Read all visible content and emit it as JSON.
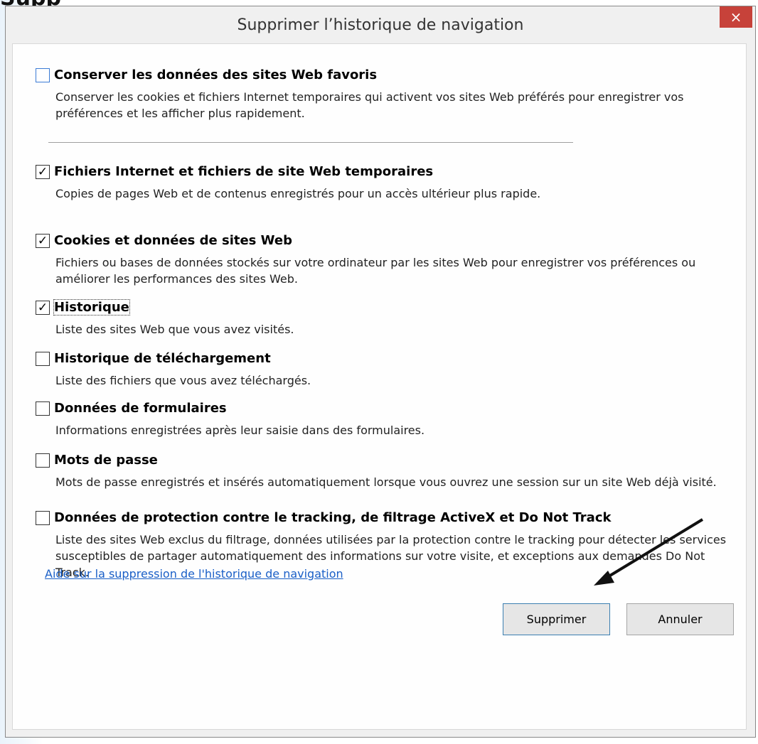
{
  "background": {
    "partial_title": "Supp"
  },
  "dialog": {
    "title": "Supprimer l’historique de navigation",
    "close_icon": "×"
  },
  "options": [
    {
      "checked": false,
      "title": "Conserver les données des sites Web favoris",
      "description": "Conserver les cookies et fichiers Internet temporaires qui activent vos sites Web préférés pour enregistrer vos préférences et les afficher plus rapidement."
    },
    {
      "checked": true,
      "title": "Fichiers Internet et fichiers de site Web temporaires",
      "description": "Copies de pages Web et de contenus enregistrés pour un accès ultérieur plus rapide."
    },
    {
      "checked": true,
      "title": "Cookies et données de sites Web",
      "description": "Fichiers ou bases de données stockés sur votre ordinateur par les sites Web pour enregistrer vos préférences ou améliorer les performances des sites Web."
    },
    {
      "checked": true,
      "title": "Historique",
      "description": "Liste des sites Web que vous avez visités."
    },
    {
      "checked": false,
      "title": "Historique de téléchargement",
      "description": "Liste des fichiers que vous avez téléchargés."
    },
    {
      "checked": false,
      "title": "Données de formulaires",
      "description": "Informations enregistrées après leur saisie dans des formulaires."
    },
    {
      "checked": false,
      "title": "Mots de passe",
      "description": "Mots de passe enregistrés et insérés automatiquement lorsque vous ouvrez une session sur un site Web déjà visité."
    },
    {
      "checked": false,
      "title": "Données de protection contre le tracking, de filtrage ActiveX et Do Not Track",
      "description": "Liste des sites Web exclus du filtrage, données utilisées par la protection contre le tracking pour détecter les services susceptibles de partager automatiquement des informations sur votre visite, et exceptions aux demandes Do Not Track."
    }
  ],
  "checkmark": "✓",
  "help_link": "Aide sur la suppression de l'historique de navigation",
  "buttons": {
    "delete": "Supprimer",
    "cancel": "Annuler"
  },
  "colors": {
    "close": "#c7423a",
    "link": "#1a5fc7",
    "primary_border": "#3c7fb1"
  }
}
